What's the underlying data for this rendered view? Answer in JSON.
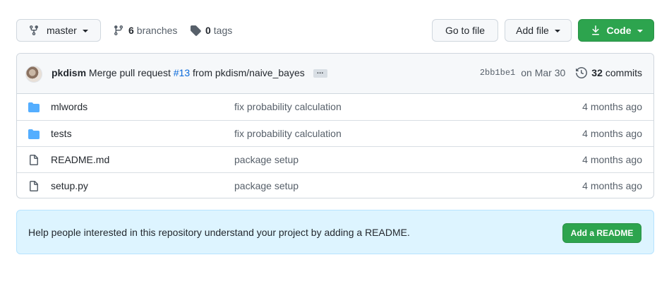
{
  "toolbar": {
    "branch_label": "master",
    "branches_count": "6",
    "branches_label": "branches",
    "tags_count": "0",
    "tags_label": "tags",
    "go_to_file_label": "Go to file",
    "add_file_label": "Add file",
    "code_label": "Code"
  },
  "commit": {
    "author": "pkdism",
    "message_prefix": "Merge pull request",
    "pr_ref": "#13",
    "message_suffix": "from pkdism/naive_bayes",
    "ellipsis": "…",
    "sha": "2bb1be1",
    "date": "on Mar 30",
    "commits_count": "32",
    "commits_label": "commits"
  },
  "files": [
    {
      "type": "folder",
      "name": "mlwords",
      "message": "fix probability calculation",
      "age": "4 months ago"
    },
    {
      "type": "folder",
      "name": "tests",
      "message": "fix probability calculation",
      "age": "4 months ago"
    },
    {
      "type": "file",
      "name": "README.md",
      "message": "package setup",
      "age": "4 months ago"
    },
    {
      "type": "file",
      "name": "setup.py",
      "message": "package setup",
      "age": "4 months ago"
    }
  ],
  "readme": {
    "prompt": "Help people interested in this repository understand your project by adding a README.",
    "button_label": "Add a README"
  },
  "colors": {
    "primary_green": "#2da44e",
    "link_blue": "#0969da",
    "folder_blue": "#54aeff",
    "readme_bg": "#ddf4ff"
  }
}
